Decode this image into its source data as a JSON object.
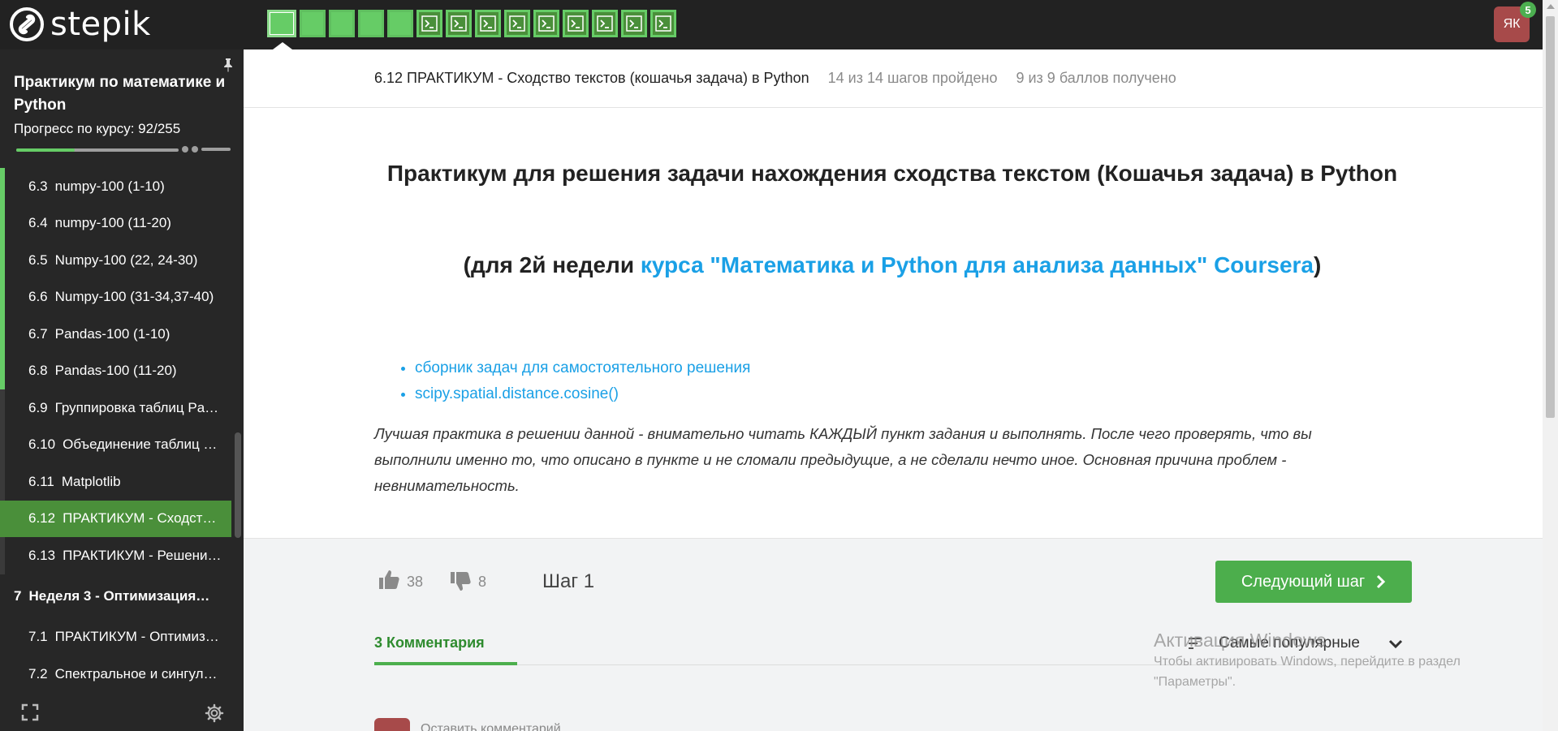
{
  "brand": {
    "name": "stepik"
  },
  "steps": [
    {
      "type": "text",
      "state": "active"
    },
    {
      "type": "text",
      "state": "done"
    },
    {
      "type": "text",
      "state": "done"
    },
    {
      "type": "text",
      "state": "done"
    },
    {
      "type": "text",
      "state": "done"
    },
    {
      "type": "code",
      "state": "done"
    },
    {
      "type": "code",
      "state": "done"
    },
    {
      "type": "code",
      "state": "done"
    },
    {
      "type": "code",
      "state": "done"
    },
    {
      "type": "code",
      "state": "done"
    },
    {
      "type": "code",
      "state": "done"
    },
    {
      "type": "code",
      "state": "done"
    },
    {
      "type": "code",
      "state": "done"
    },
    {
      "type": "code",
      "state": "done"
    }
  ],
  "user": {
    "initials": "ЯК",
    "notifications": "5"
  },
  "sidebar": {
    "course_title": "Практикум по математике и Python",
    "progress_label": "Прогресс по курсу:  92/255",
    "progress_value": 0.36,
    "lessons": [
      {
        "num": "6.3",
        "title": "numpy-100 (1-10)",
        "kind": "done"
      },
      {
        "num": "6.4",
        "title": "numpy-100 (11-20)",
        "kind": "done"
      },
      {
        "num": "6.5",
        "title": "Numpy-100 (22, 24-30)",
        "kind": "done"
      },
      {
        "num": "6.6",
        "title": "Numpy-100 (31-34,37-40)",
        "kind": "done"
      },
      {
        "num": "6.7",
        "title": "Pandas-100 (1-10)",
        "kind": "done"
      },
      {
        "num": "6.8",
        "title": "Pandas-100 (11-20)",
        "kind": "done"
      },
      {
        "num": "6.9",
        "title": "Группировка таблиц Pa…",
        "kind": "partial"
      },
      {
        "num": "6.10",
        "title": "Объединение таблиц …",
        "kind": "partial"
      },
      {
        "num": "6.11",
        "title": "Matplotlib",
        "kind": "partial"
      },
      {
        "num": "6.12",
        "title": "ПРАКТИКУМ - Сходст…",
        "kind": "active"
      },
      {
        "num": "6.13",
        "title": "ПРАКТИКУМ - Решени…",
        "kind": "partial"
      },
      {
        "num": "7",
        "title": "Неделя 3 - Оптимизация…",
        "kind": "module"
      },
      {
        "num": "7.1",
        "title": "ПРАКТИКУМ - Оптимиз…",
        "kind": "plain"
      },
      {
        "num": "7.2",
        "title": "Спектральное и сингул…",
        "kind": "plain"
      }
    ]
  },
  "header": {
    "lesson_title": "6.12 ПРАКТИКУМ - Сходство текстов (кошачья задача) в Python",
    "steps_done": "14 из 14 шагов пройдено",
    "points": "9 из 9 баллов  получено"
  },
  "content": {
    "title": "Практикум для решения задачи нахождения сходства текстом (Кошачья задача) в Python",
    "subtitle_prefix": "(для 2й недели ",
    "subtitle_link": "курса \"Математика и Python для анализа данных\" Coursera",
    "subtitle_suffix": ")",
    "links": [
      "сборник задач для самостоятельного решения",
      "scipy.spatial.distance.cosine()"
    ],
    "note": "Лучшая практика в решении данной - внимательно читать КАЖДЫЙ пункт задания и выполнять. После чего проверять, что вы выполнили именно то, что описано в пункте и не сломали предыдущие, а не сделали нечто иное. Основная причина проблем - невнимательность."
  },
  "footer": {
    "likes": "38",
    "dislikes": "8",
    "step_label": "Шаг 1",
    "next_button": "Следующий шаг",
    "comments_tab": "3  Комментария",
    "sort_label": "Самые популярные",
    "comment_placeholder": "Оставить комментарий"
  },
  "watermark": {
    "title": "Активация Windows",
    "text": "Чтобы активировать Windows, перейдите в раздел \"Параметры\"."
  },
  "colors": {
    "accent_green": "#66cc66",
    "active_green": "#4a8f3a",
    "link_blue": "#1aa0e6",
    "topbar": "#222222",
    "sidebar": "#272727"
  }
}
